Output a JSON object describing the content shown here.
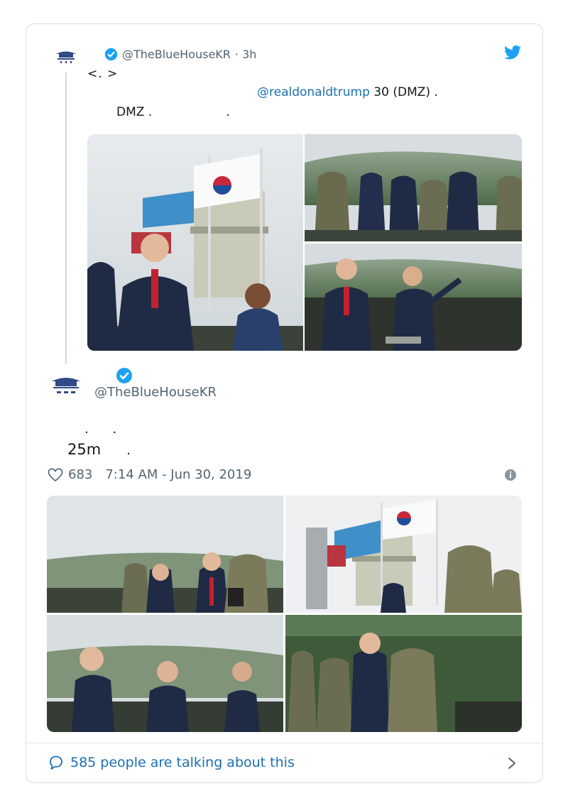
{
  "parent_tweet": {
    "handle": "@TheBlueHouseKR",
    "time": "· 3h",
    "line1": "<.  >",
    "mention": "@realdonaldtrump",
    "line2_rest": " 30 (DMZ) .",
    "line3_a": "DMZ .",
    "line3_b": ".",
    "avatar_icon": "blue-house-logo-icon",
    "verified_icon": "verified-badge-icon",
    "bird_icon": "twitter-bird-icon"
  },
  "main_tweet": {
    "handle": "@TheBlueHouseKR",
    "dots": ". .",
    "duration": "25m",
    "duration_dot": ".",
    "likes": "683",
    "timestamp": "7:14 AM - Jun 30, 2019",
    "heart_icon": "heart-icon",
    "info_icon": "info-icon"
  },
  "footer": {
    "talking_text": "585 people are talking about this",
    "comment_icon": "comment-bubble-icon",
    "chevron_icon": "chevron-right-icon"
  },
  "colors": {
    "link": "#1b6fb0",
    "twitter_blue": "#1da1f2",
    "muted": "#536471",
    "border": "#d8dde2"
  }
}
